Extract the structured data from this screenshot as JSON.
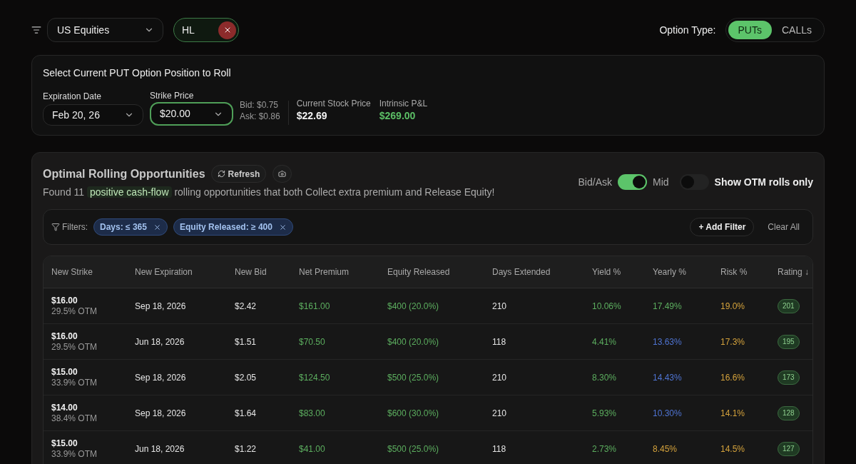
{
  "toolbar": {
    "market": "US Equities",
    "ticker": "HL",
    "option_type": {
      "label": "Option Type:",
      "options": [
        {
          "label": "PUTs",
          "selected": true
        },
        {
          "label": "CALLs",
          "selected": false
        }
      ]
    }
  },
  "position": {
    "title": "Select Current PUT Option Position to Roll",
    "expiration": {
      "label": "Expiration Date",
      "value": "Feb 20, 26",
      "focused": false
    },
    "strike": {
      "label": "Strike Price",
      "value": "$20.00",
      "focused": true
    },
    "bid": "Bid: $0.75",
    "ask": "Ask: $0.86",
    "stats": [
      {
        "label": "Current Stock Price",
        "value": "$22.69",
        "kind": "neutral"
      },
      {
        "label": "Intrinsic P&L",
        "value": "$269.00",
        "kind": "positive"
      }
    ]
  },
  "opportunities": {
    "title": "Optimal Rolling Opportunities",
    "refresh": "Refresh",
    "summary": {
      "before": "Found 11",
      "highlight": "positive cash-flow",
      "after": "rolling opportunities that both Collect extra premium and Release Equity!"
    },
    "price_toggle": {
      "left": "Bid/Ask",
      "right": "Mid",
      "on": true
    },
    "otm_toggle": {
      "label": "Show OTM rolls only",
      "on": false
    },
    "filters": {
      "label": "Filters:",
      "chips": [
        "Days: ≤ 365",
        "Equity Released: ≥ 400"
      ],
      "add": "+ Add Filter",
      "clear": "Clear All"
    },
    "table": {
      "columns": [
        "New Strike",
        "New Expiration",
        "New Bid",
        "Net Premium",
        "Equity Released",
        "Days Extended",
        "Yield %",
        "Yearly %",
        "Risk %",
        "Rating ↓"
      ],
      "rows": [
        {
          "strike": "$16.00",
          "otm": "29.5% OTM",
          "expiration": "Sep 18, 2026",
          "bid": "$2.42",
          "net_premium": "$161.00",
          "equity_released": "$400 (20.0%)",
          "days": "210",
          "yield": "10.06%",
          "yearly": {
            "text": "17.49%",
            "color": "#5cae5f"
          },
          "risk": "19.0%",
          "rating": "201"
        },
        {
          "strike": "$16.00",
          "otm": "29.5% OTM",
          "expiration": "Jun 18, 2026",
          "bid": "$1.51",
          "net_premium": "$70.50",
          "equity_released": "$400 (20.0%)",
          "days": "118",
          "yield": "4.41%",
          "yearly": {
            "text": "13.63%",
            "color": "#4f74d2"
          },
          "risk": "17.3%",
          "rating": "195"
        },
        {
          "strike": "$15.00",
          "otm": "33.9% OTM",
          "expiration": "Sep 18, 2026",
          "bid": "$2.05",
          "net_premium": "$124.50",
          "equity_released": "$500 (25.0%)",
          "days": "210",
          "yield": "8.30%",
          "yearly": {
            "text": "14.43%",
            "color": "#4f74d2"
          },
          "risk": "16.6%",
          "rating": "173"
        },
        {
          "strike": "$14.00",
          "otm": "38.4% OTM",
          "expiration": "Sep 18, 2026",
          "bid": "$1.64",
          "net_premium": "$83.00",
          "equity_released": "$600 (30.0%)",
          "days": "210",
          "yield": "5.93%",
          "yearly": {
            "text": "10.30%",
            "color": "#4f74d2"
          },
          "risk": "14.1%",
          "rating": "128"
        },
        {
          "strike": "$15.00",
          "otm": "33.9% OTM",
          "expiration": "Jun 18, 2026",
          "bid": "$1.22",
          "net_premium": "$41.00",
          "equity_released": "$500 (25.0%)",
          "days": "118",
          "yield": "2.73%",
          "yearly": {
            "text": "8.45%",
            "color": "#d4a23c"
          },
          "risk": "14.5%",
          "rating": "127"
        }
      ]
    }
  }
}
